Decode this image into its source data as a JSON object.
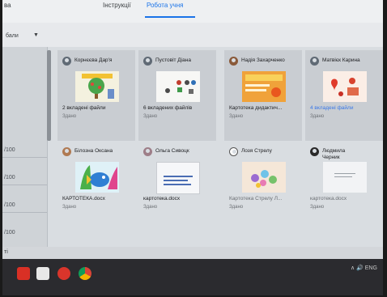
{
  "tabs": {
    "left_partial": "ва",
    "instructions": "Інструкції",
    "student_work": "Робота учня"
  },
  "filter": {
    "label": "бали"
  },
  "scores": [
    "/100",
    "/100",
    "/100",
    "/100"
  ],
  "bottom_partial": "ті",
  "tray": {
    "text": "∧ 🔊 ENG"
  },
  "cards": [
    {
      "name": "Корнєєва Дар'я",
      "attachment": "2 вкладені файли",
      "status": "Здано",
      "thumb": "tree"
    },
    {
      "name": "Пустовіт Діана",
      "attachment": "6 вкладених файлів",
      "status": "Здано",
      "thumb": "dots"
    },
    {
      "name": "Надія Захарченко",
      "attachment": "Картотека дидактич...",
      "status": "Здано",
      "thumb": "orange"
    },
    {
      "name": "Матвієк Карина",
      "attachment": "4 вкладені файли",
      "status": "Здано",
      "thumb": "red"
    },
    {
      "name": "Білозна Оксана",
      "attachment": "КАРТОТЕКА.docx",
      "status": "Здано",
      "thumb": "fish"
    },
    {
      "name": "Ольга Сивоцк",
      "attachment": "картотека.docx",
      "status": "Здано",
      "thumb": "doc"
    },
    {
      "name": "Лозя Стрелу",
      "attachment": "Картотека Стрелу Л...",
      "status": "Здано",
      "thumb": "flowers"
    },
    {
      "name": "Людмила Черник",
      "attachment": "картотека.docx",
      "status": "Здано",
      "thumb": "blank"
    }
  ]
}
